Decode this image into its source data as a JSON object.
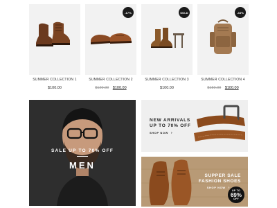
{
  "products": [
    {
      "name": "SUMMER COLLECTION 1",
      "badge": "",
      "old_price": "",
      "price": "$100.00",
      "on_sale": false,
      "image": "brown-boots"
    },
    {
      "name": "SUMMER COLLECTION 2",
      "badge": "-17%",
      "old_price": "$120.00",
      "price": "$100.00",
      "on_sale": true,
      "image": "brown-loafers"
    },
    {
      "name": "SUMMER COLLECTION 3",
      "badge": "SOLD",
      "old_price": "",
      "price": "$100.00",
      "on_sale": false,
      "image": "chelsea-boots-on-stool"
    },
    {
      "name": "SUMMER COLLECTION 4",
      "badge": "-33%",
      "old_price": "$150.00",
      "price": "$100.00",
      "on_sale": true,
      "image": "tan-backpack"
    }
  ],
  "banners": {
    "men": {
      "subtitle": "SALE UP TO 70% OFF",
      "title": "MEN",
      "image": "bearded-man-with-glasses"
    },
    "belt": {
      "line1": "NEW ARRIVALS",
      "line2": "UP TO 70% OFF",
      "cta": "SHOP NOW",
      "image": "brown-leather-belt"
    },
    "shoes": {
      "line1": "SUPPER SALE",
      "line2": "FASHION SHOES",
      "cta": "SHOP NOW",
      "badge_top": "UP TO",
      "badge_pct": "69%",
      "badge_bottom": "OFF",
      "image": "brown-oxford-shoes-on-wood"
    }
  },
  "icons": {
    "arrow": "arrow-right-icon"
  },
  "colors": {
    "badge_bg": "#1a1a1a",
    "men_bg": "#2e2e2e",
    "belt_bg": "#efefef",
    "shoes_bg": "#b79a77"
  }
}
